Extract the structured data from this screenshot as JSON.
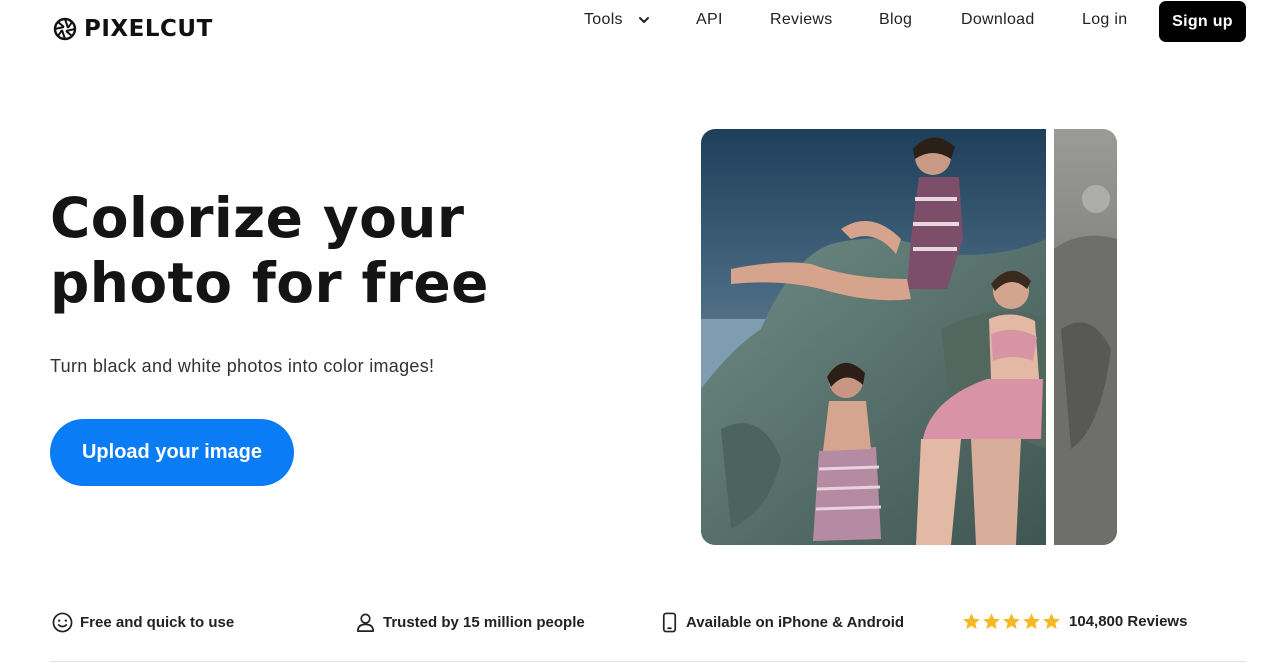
{
  "brand": {
    "name": "PIXELCUT",
    "logo_icon": "aperture-icon"
  },
  "nav": {
    "tools_label": "Tools",
    "api_label": "API",
    "reviews_label": "Reviews",
    "blog_label": "Blog",
    "download_label": "Download",
    "login_label": "Log in",
    "signup_label": "Sign up"
  },
  "hero": {
    "title": "Colorize your photo for free",
    "subtitle": "Turn black and white photos into color images!",
    "upload_label": "Upload your image"
  },
  "features": {
    "free": {
      "icon": "smiley-icon",
      "label": "Free and quick to use"
    },
    "trusted": {
      "icon": "person-icon",
      "label": "Trusted by 15 million people"
    },
    "available": {
      "icon": "phone-icon",
      "label": "Available on iPhone & Android"
    },
    "reviews": {
      "icon": "star-icon",
      "rating": 5,
      "label": "104,800 Reviews"
    }
  },
  "colors": {
    "accent": "#0a7cf5",
    "signup_bg": "#000000",
    "star": "#f5b921"
  }
}
